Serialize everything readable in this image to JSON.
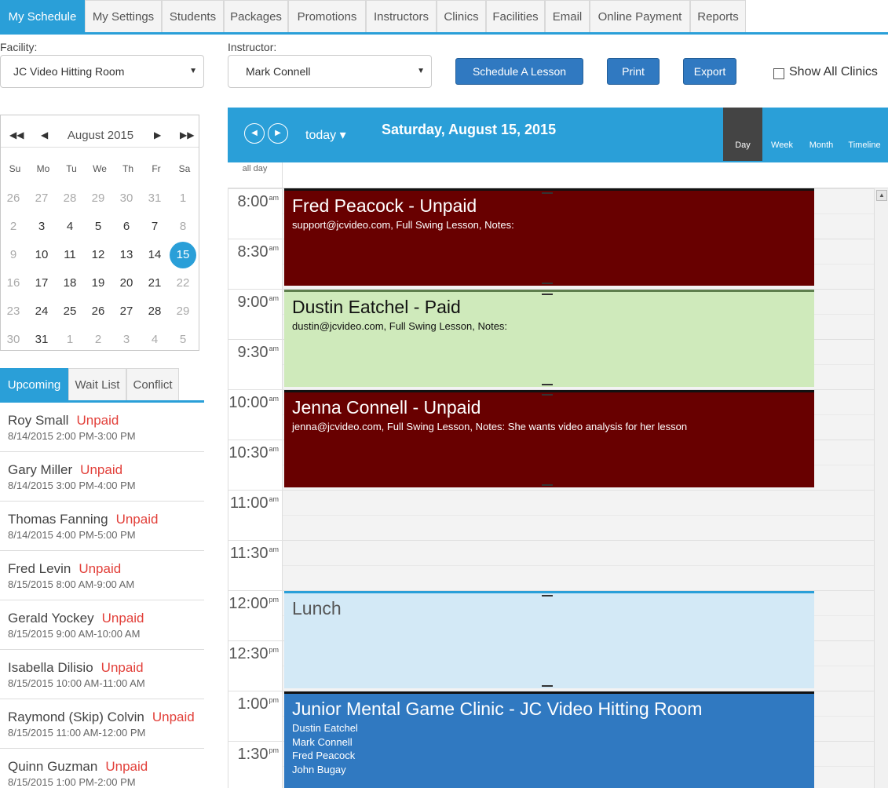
{
  "nav": {
    "tabs": [
      {
        "label": "My Schedule"
      },
      {
        "label": "My Settings"
      },
      {
        "label": "Students"
      },
      {
        "label": "Packages"
      },
      {
        "label": "Promotions"
      },
      {
        "label": "Instructors"
      },
      {
        "label": "Clinics"
      },
      {
        "label": "Facilities"
      },
      {
        "label": "Email"
      },
      {
        "label": "Online Payment"
      },
      {
        "label": "Reports"
      }
    ],
    "active": "My Schedule"
  },
  "filters": {
    "facility_label": "Facility:",
    "facility_value": "JC Video Hitting Room",
    "instructor_label": "Instructor:",
    "instructor_value": "Mark Connell",
    "schedule_button": "Schedule A Lesson",
    "print_button": "Print",
    "export_button": "Export",
    "show_all_clinics": "Show All Clinics"
  },
  "mini_calendar": {
    "month": "August 2015",
    "prev_year": "◀◀",
    "prev": "◀",
    "next": "▶",
    "next_year": "▶▶",
    "dow": [
      "Su",
      "Mo",
      "Tu",
      "We",
      "Th",
      "Fr",
      "Sa"
    ],
    "weeks": [
      [
        "26",
        "27",
        "28",
        "29",
        "30",
        "31",
        "1"
      ],
      [
        "2",
        "3",
        "4",
        "5",
        "6",
        "7",
        "8"
      ],
      [
        "9",
        "10",
        "11",
        "12",
        "13",
        "14",
        "15"
      ],
      [
        "16",
        "17",
        "18",
        "19",
        "20",
        "21",
        "22"
      ],
      [
        "23",
        "24",
        "25",
        "26",
        "27",
        "28",
        "29"
      ],
      [
        "30",
        "31",
        "1",
        "2",
        "3",
        "4",
        "5"
      ]
    ],
    "selected": "15"
  },
  "side_tabs": [
    {
      "label": "Upcoming"
    },
    {
      "label": "Wait List"
    },
    {
      "label": "Conflict"
    }
  ],
  "upcoming": [
    {
      "name": "Roy Small",
      "status": "Unpaid",
      "when": "8/14/2015  2:00 PM-3:00 PM"
    },
    {
      "name": "Gary Miller",
      "status": "Unpaid",
      "when": "8/14/2015  3:00 PM-4:00 PM"
    },
    {
      "name": "Thomas Fanning",
      "status": "Unpaid",
      "when": "8/14/2015  4:00 PM-5:00 PM"
    },
    {
      "name": "Fred Levin",
      "status": "Unpaid",
      "when": "8/15/2015  8:00 AM-9:00 AM"
    },
    {
      "name": "Gerald Yockey",
      "status": "Unpaid",
      "when": "8/15/2015  9:00 AM-10:00 AM"
    },
    {
      "name": "Isabella Dilisio",
      "status": "Unpaid",
      "when": "8/15/2015  10:00 AM-11:00 AM"
    },
    {
      "name": "Raymond (Skip) Colvin",
      "status": "Unpaid",
      "when": "8/15/2015  11:00 AM-12:00 PM"
    },
    {
      "name": "Quinn Guzman",
      "status": "Unpaid",
      "when": "8/15/2015  1:00 PM-2:00 PM"
    }
  ],
  "schedule": {
    "prev": "◀",
    "next": "▶",
    "today": "today ▾",
    "date_title": "Saturday, August 15, 2015",
    "views": [
      {
        "label": "Day"
      },
      {
        "label": "Week"
      },
      {
        "label": "Month"
      },
      {
        "label": "Timeline"
      }
    ],
    "active_view": "Day",
    "all_day_label": "all day",
    "times": [
      {
        "t": "8:00",
        "ap": "am"
      },
      {
        "t": "8:30",
        "ap": "am"
      },
      {
        "t": "9:00",
        "ap": "am"
      },
      {
        "t": "9:30",
        "ap": "am"
      },
      {
        "t": "10:00",
        "ap": "am"
      },
      {
        "t": "10:30",
        "ap": "am"
      },
      {
        "t": "11:00",
        "ap": "am"
      },
      {
        "t": "11:30",
        "ap": "am"
      },
      {
        "t": "12:00",
        "ap": "pm"
      },
      {
        "t": "12:30",
        "ap": "pm"
      },
      {
        "t": "1:00",
        "ap": "pm"
      },
      {
        "t": "1:30",
        "ap": "pm"
      }
    ],
    "events": [
      {
        "kind": "unpaid",
        "title": "Fred Peacock - Unpaid",
        "details": [
          "support@jcvideo.com, Full Swing Lesson, Notes:"
        ]
      },
      {
        "kind": "paid",
        "title": "Dustin Eatchel - Paid",
        "details": [
          "dustin@jcvideo.com, Full Swing Lesson, Notes:"
        ]
      },
      {
        "kind": "unpaid",
        "title": "Jenna Connell - Unpaid",
        "details": [
          "jenna@jcvideo.com, Full Swing Lesson, Notes:  She wants video analysis for her lesson"
        ]
      },
      {
        "kind": "lunch",
        "title": "Lunch",
        "details": []
      },
      {
        "kind": "clinic",
        "title": "Junior Mental Game Clinic - JC Video Hitting Room",
        "details": [
          "Dustin Eatchel",
          "Mark Connell",
          "Fred Peacock",
          "John Bugay"
        ]
      }
    ]
  }
}
